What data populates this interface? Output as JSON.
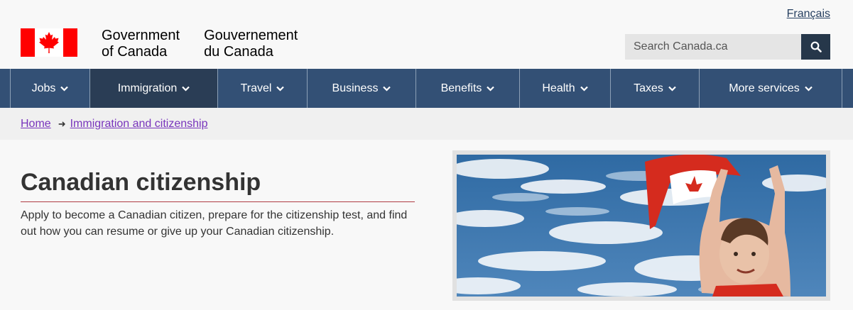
{
  "header": {
    "language_link": "Français",
    "gov_en_line1": "Government",
    "gov_en_line2": "of Canada",
    "gov_fr_line1": "Gouvernement",
    "gov_fr_line2": "du Canada",
    "search_placeholder": "Search Canada.ca",
    "flag_color": "#ff0000"
  },
  "menu": {
    "items": [
      {
        "label": "Jobs"
      },
      {
        "label": "Immigration"
      },
      {
        "label": "Travel"
      },
      {
        "label": "Business"
      },
      {
        "label": "Benefits"
      },
      {
        "label": "Health"
      },
      {
        "label": "Taxes"
      },
      {
        "label": "More services"
      }
    ],
    "active": "Immigration",
    "background": "#335075"
  },
  "breadcrumb": {
    "items": [
      "Home",
      "Immigration and citizenship"
    ]
  },
  "main": {
    "title": "Canadian citizenship",
    "description": "Apply to become a Canadian citizen, prepare for the citizenship test, and find out how you can resume or give up your Canadian citizenship.",
    "rule_color": "#af3c43"
  }
}
